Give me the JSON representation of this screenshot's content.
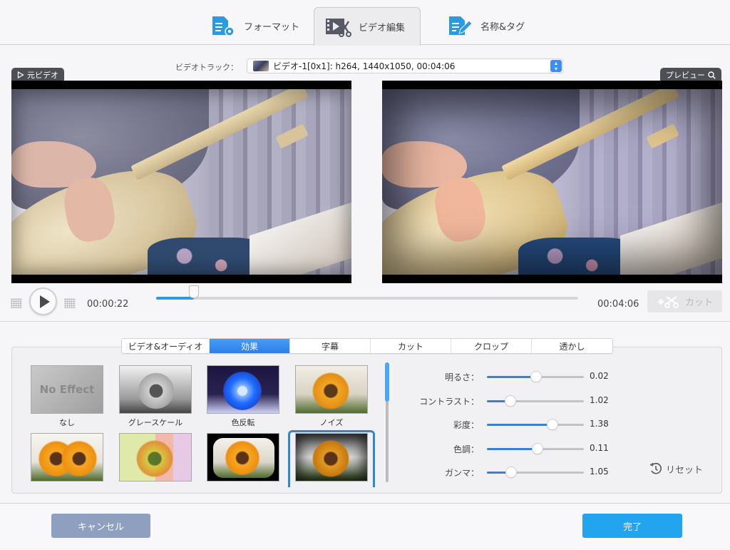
{
  "top_tabs": [
    {
      "label": "フォーマット",
      "icon": "format-settings-icon",
      "active": false
    },
    {
      "label": "ビデオ編集",
      "icon": "video-edit-icon",
      "active": true
    },
    {
      "label": "名称&タグ",
      "icon": "name-tag-edit-icon",
      "active": false
    }
  ],
  "video_track": {
    "label": "ビデオトラック：",
    "selected": "ビデオ-1[0x1]: h264, 1440x1050, 00:04:06"
  },
  "source_video": {
    "label": "元ビデオ",
    "icon": "play-outline-icon"
  },
  "preview_video": {
    "label": "プレビュー",
    "icon": "magnifier-icon"
  },
  "playback": {
    "current_time": "00:00:22",
    "total_time": "00:04:06",
    "progress": 0.09,
    "cut_label": "カット"
  },
  "sub_tabs": [
    {
      "label": "ビデオ&オーディオ",
      "active": false
    },
    {
      "label": "効果",
      "active": true
    },
    {
      "label": "字幕",
      "active": false
    },
    {
      "label": "カット",
      "active": false
    },
    {
      "label": "クロップ",
      "active": false
    },
    {
      "label": "透かし",
      "active": false
    }
  ],
  "effects": [
    {
      "caption": "なし",
      "thumb_text": "No Effect",
      "selected": false
    },
    {
      "caption": "グレースケール",
      "selected": false
    },
    {
      "caption": "色反転",
      "selected": false
    },
    {
      "caption": "ノイズ",
      "selected": false
    },
    {
      "caption": "",
      "selected": false
    },
    {
      "caption": "",
      "selected": false
    },
    {
      "caption": "",
      "selected": false
    },
    {
      "caption": "",
      "selected": true
    }
  ],
  "effects_scroll_position": 0.0,
  "adjustments": [
    {
      "label": "明るさ：",
      "value": "0.02",
      "fraction": 0.51
    },
    {
      "label": "コントラスト：",
      "value": "1.02",
      "fraction": 0.24
    },
    {
      "label": "彩度：",
      "value": "1.38",
      "fraction": 0.68
    },
    {
      "label": "色調：",
      "value": "0.11",
      "fraction": 0.52
    },
    {
      "label": "ガンマ：",
      "value": "1.05",
      "fraction": 0.25
    }
  ],
  "reset_label": "リセット",
  "buttons": {
    "cancel": "キャンセル",
    "done": "完了"
  },
  "colors": {
    "accent": "#2a9be0",
    "done_button": "#22a4ef",
    "cancel_button": "#8e9fc0",
    "active_tab": "#2a7ee8"
  }
}
